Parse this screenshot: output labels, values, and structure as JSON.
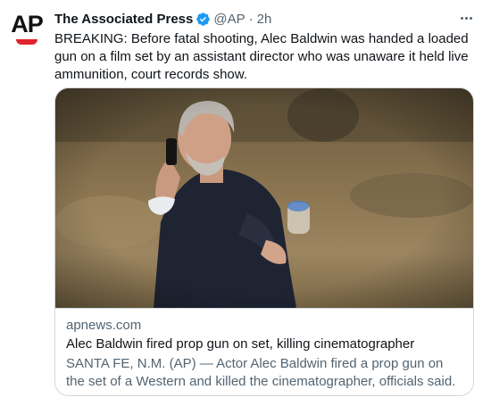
{
  "tweet": {
    "author_name": "The Associated Press",
    "handle": "@AP",
    "separator": "·",
    "time": "2h",
    "text": "BREAKING: Before fatal shooting, Alec Baldwin was handed a loaded gun on a film set by an assistant director who was unaware it held live ammunition, court records show.",
    "avatar_logo_text": "AP"
  },
  "card": {
    "domain": "apnews.com",
    "title": "Alec Baldwin fired prop gun on set, killing cinematographer",
    "description": "SANTA FE, N.M. (AP) — Actor Alec Baldwin fired a prop gun on the set of a Western and killed the cinematographer, officials said. The direct…"
  },
  "icons": {
    "verified": "verified-badge-icon",
    "more": "more-options-icon"
  },
  "colors": {
    "accent": "#1d9bf0",
    "text": "#0f1419",
    "secondary": "#536471",
    "ap_red": "#e0222b"
  }
}
